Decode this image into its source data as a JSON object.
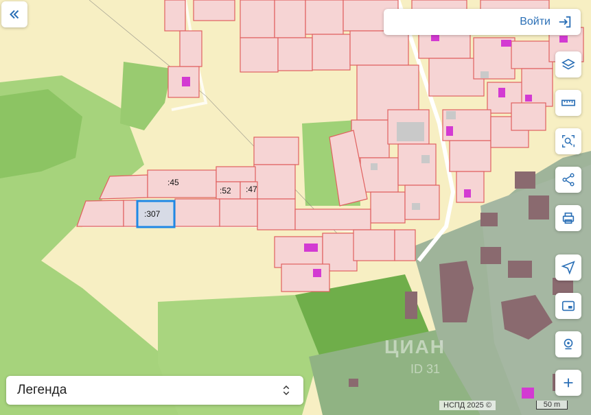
{
  "header": {
    "login_label": "Войти"
  },
  "legend": {
    "label": "Легенда"
  },
  "map": {
    "parcel_labels": [
      ":45",
      ":52",
      ":47",
      ":307"
    ],
    "selected_parcel": ":307",
    "attribution": "НСПД 2025 ©",
    "scale_label": "50 m",
    "watermark": "ЦИАН",
    "watermark_id": "ID 31"
  },
  "colors": {
    "parcel_fill": "#f6d4d4",
    "parcel_border": "#e0605f",
    "building": "#d33ad2",
    "forest": "#9ccf6a",
    "field": "#f7efc3",
    "selection": "#1e88e5",
    "accent": "#2a6fb6"
  },
  "toolbar": {
    "icons": [
      "layers-icon",
      "ruler-icon",
      "search-area-icon",
      "share-icon",
      "print-icon",
      "locate-icon",
      "map-frame-icon",
      "geolocation-icon",
      "zoom-in-icon"
    ]
  }
}
